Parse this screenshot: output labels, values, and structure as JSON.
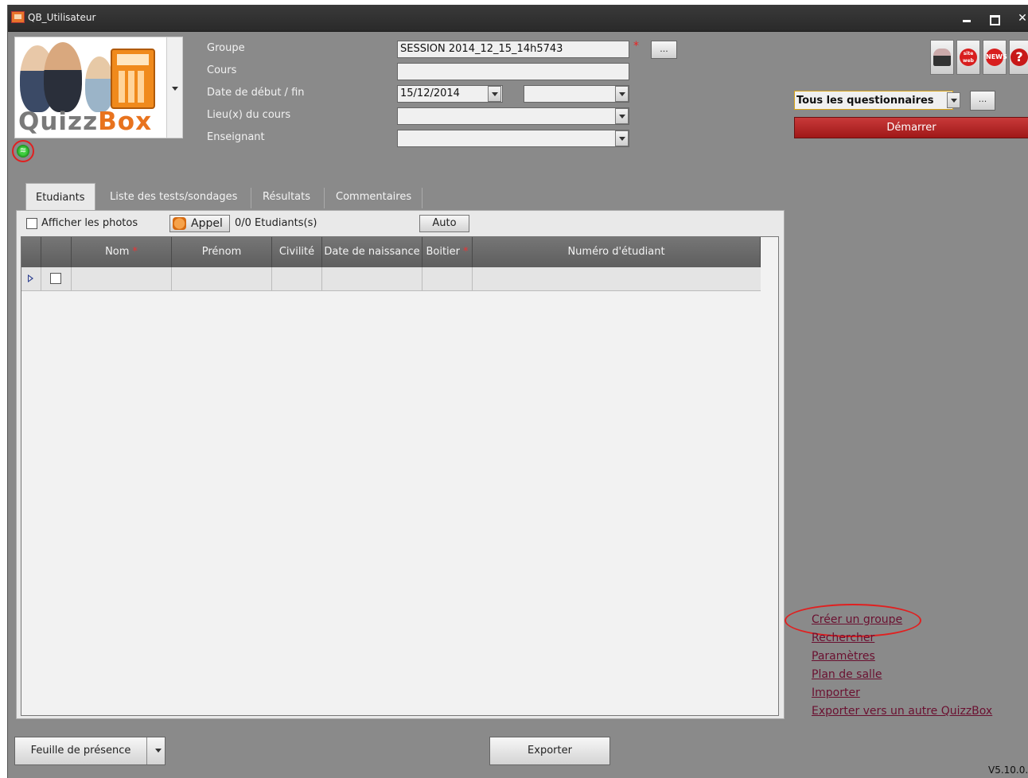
{
  "window": {
    "title": "QB_Utilisateur"
  },
  "logo": {
    "brand_left": "Quizz",
    "brand_right": "Box"
  },
  "form": {
    "groupe_label": "Groupe",
    "groupe_value": "SESSION 2014_12_15_14h5743",
    "groupe_required": "*",
    "groupe_browse": "...",
    "cours_label": "Cours",
    "cours_value": "",
    "dates_label": "Date de début / fin",
    "date_start": "15/12/2014",
    "date_end": "",
    "lieu_label": "Lieu(x) du cours",
    "lieu_value": "",
    "enseignant_label": "Enseignant",
    "enseignant_value": ""
  },
  "toolbar_icons": [
    "user-icon",
    "web-icon",
    "news-icon",
    "help-icon"
  ],
  "toolbar_icon_texts": {
    "web": "site web",
    "news": "NEWS",
    "help": "?"
  },
  "questionnaires": {
    "selected": "Tous les questionnaires",
    "browse": "...",
    "start_label": "Démarrer"
  },
  "tabs": [
    {
      "label": "Etudiants",
      "active": true
    },
    {
      "label": "Liste des tests/sondages",
      "active": false
    },
    {
      "label": "Résultats",
      "active": false
    },
    {
      "label": "Commentaires",
      "active": false
    }
  ],
  "students_toolbar": {
    "show_photos_label": "Afficher les photos",
    "appel_label": "Appel",
    "count_label": "0/0 Etudiants(s)",
    "auto_label": "Auto"
  },
  "grid": {
    "columns": [
      "Nom",
      "Prénom",
      "Civilité",
      "Date de naissance",
      "Boitier",
      "Numéro d'étudiant"
    ],
    "required_mark": "*"
  },
  "links": [
    "Créer un groupe",
    "Rechercher",
    "Paramètres",
    "Plan de salle",
    "Importer",
    "Exporter vers un autre QuizzBox"
  ],
  "bottom": {
    "feuille_label": "Feuille de présence",
    "exporter_label": "Exporter",
    "version": "V5.10.0."
  },
  "colors": {
    "start_button": "#b02020",
    "link": "#6a1030",
    "highlight_circle": "#e02020",
    "selector_border": "#d9a418"
  }
}
